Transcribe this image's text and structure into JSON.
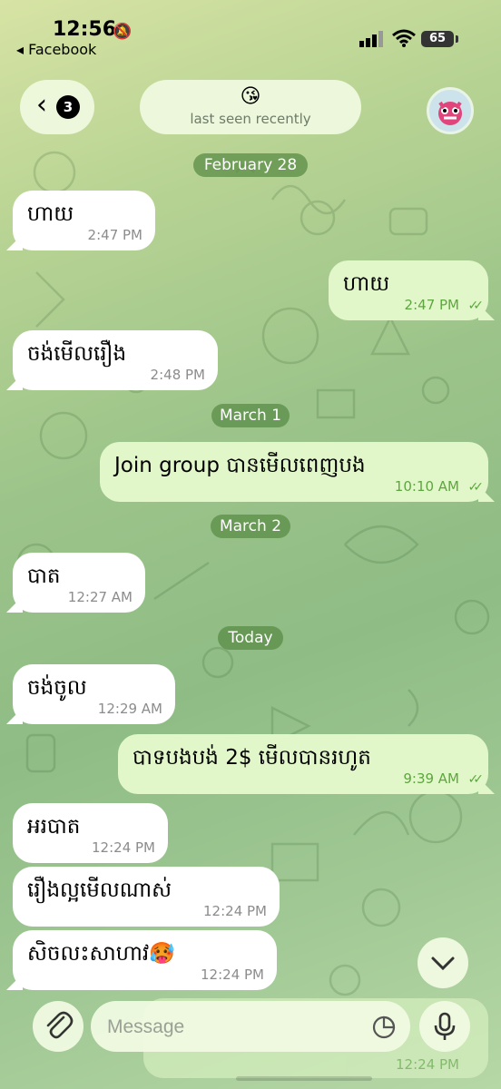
{
  "status_bar": {
    "time": "12:56",
    "back_app": "◂ Facebook",
    "battery": "65"
  },
  "header": {
    "back_badge": "3",
    "contact_emoji": "😘",
    "contact_status": "last seen recently"
  },
  "chat": {
    "dates": {
      "feb28": "February 28",
      "mar1": "March 1",
      "mar2": "March 2",
      "today": "Today"
    },
    "messages": [
      {
        "dir": "in",
        "text": "ហាយ",
        "time": "2:47 PM"
      },
      {
        "dir": "out",
        "text": "ហាយ",
        "time": "2:47 PM"
      },
      {
        "dir": "in",
        "text": "ចង់មើលរឿង",
        "time": "2:48 PM"
      },
      {
        "dir": "out",
        "text": "Join group បានមើលពេញបង",
        "time": "10:10 AM"
      },
      {
        "dir": "in",
        "text": "បាត",
        "time": "12:27 AM"
      },
      {
        "dir": "in",
        "text": "ចង់ចូល",
        "time": "12:29 AM"
      },
      {
        "dir": "out",
        "text": "បាទបងបង់ 2$ មើលបានរហូត",
        "time": "9:39 AM"
      },
      {
        "dir": "in",
        "text": "អរបាត",
        "time": "12:24 PM"
      },
      {
        "dir": "in",
        "text": "រឿងល្អមើលណាស់",
        "time": "12:24 PM"
      },
      {
        "dir": "in",
        "text": "សិចលះសាហាវ🥵",
        "time": "12:24 PM"
      }
    ],
    "peek_time": "12:24 PM"
  },
  "composer": {
    "placeholder": "Message"
  },
  "colors": {
    "incoming_bubble": "#ffffff",
    "outgoing_bubble": "#e2f7c9",
    "date_chip": "#5a8c46",
    "check_green": "#5ea640"
  }
}
